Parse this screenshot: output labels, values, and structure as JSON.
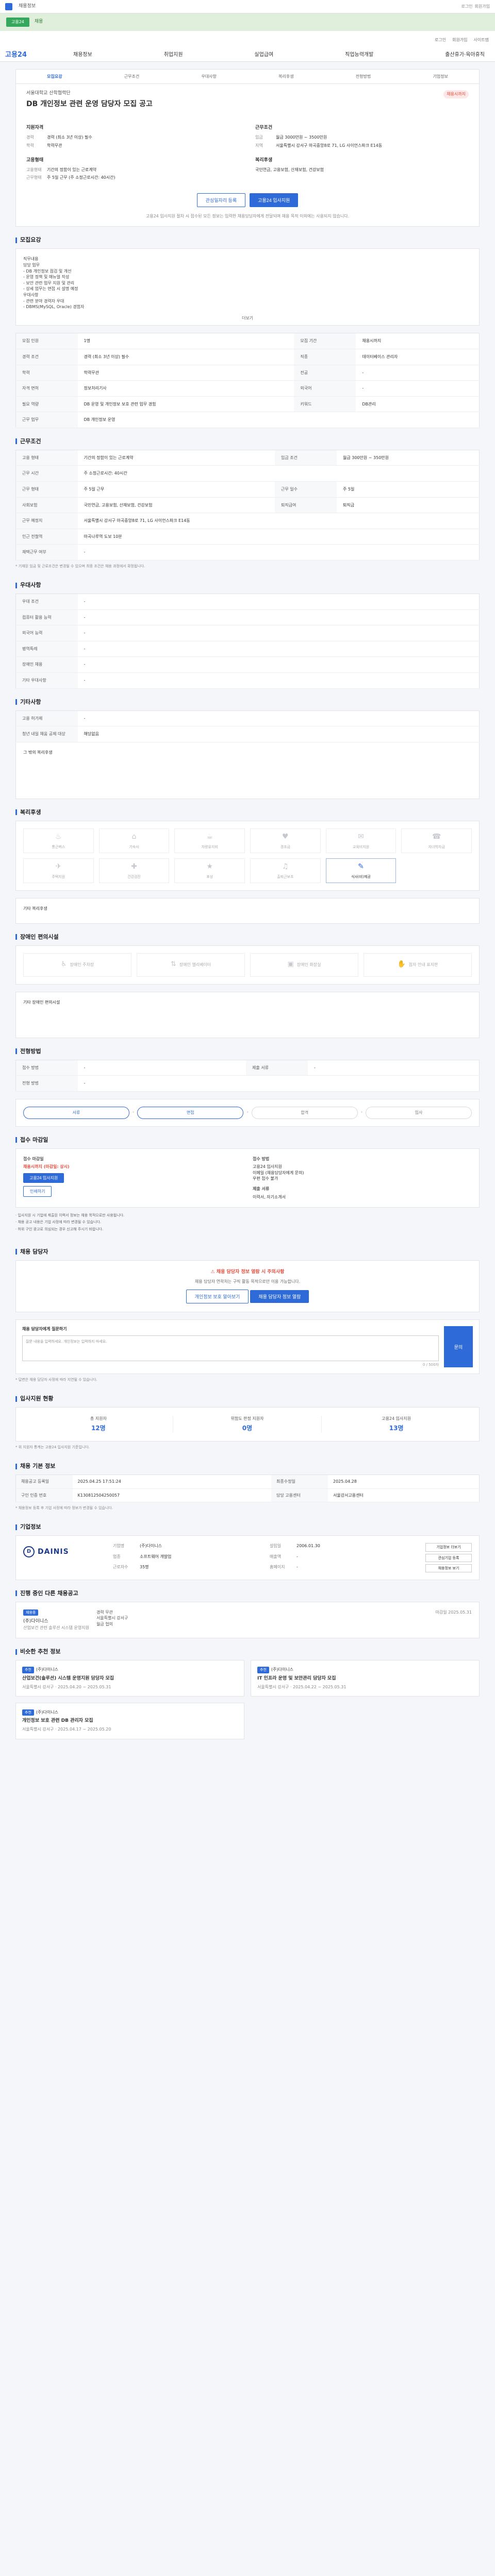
{
  "topbar": {
    "tab1": "채용정보",
    "links": [
      "로그인",
      "회원가입"
    ]
  },
  "greenbar": {
    "badge": "고용24",
    "text": "채용"
  },
  "util": {
    "items": [
      "로그인",
      "회원가입",
      "사이트맵"
    ]
  },
  "brand": "고용24",
  "mainnav": [
    "채용정보",
    "취업지원",
    "실업급여",
    "직업능력개발",
    "출산휴가·육아휴직"
  ],
  "tabs": [
    "모집요강",
    "근무조건",
    "우대사항",
    "복리후생",
    "전형방법",
    "기업정보"
  ],
  "job": {
    "company": "서울대학교 산학협력단",
    "title": "DB 개인정보 관련 운영 담당자 모집 공고",
    "status": "채용시까지",
    "recruit_head": "지원자격",
    "recruit": [
      {
        "k": "경력",
        "v": "경력 (최소 3년 이상) 필수"
      },
      {
        "k": "학력",
        "v": "학력무관"
      }
    ],
    "work_head": "근무조건",
    "work": [
      {
        "k": "임금",
        "v": "월급 3000만원 ~ 3500만원"
      },
      {
        "k": "지역",
        "v": "서울특별시 강서구 마곡중앙8로 71, LG 사이언스파크 E14동"
      }
    ],
    "emp_head": "고용형태",
    "emp": [
      {
        "k": "고용형태",
        "v": "기간의 정함이 있는 근로계약"
      },
      {
        "k": "근무형태",
        "v": "주 5일 근무 (주 소정근로시간: 40시간)"
      }
    ],
    "welfare_head": "복리후생",
    "welfare": [
      {
        "k": "",
        "v": "국민연금, 고용보험, 산재보험, 건강보험"
      }
    ],
    "btn_save": "관심일자리 등록",
    "btn_apply": "고용24 입사지원",
    "notice": "고용24 입사지원 절차 시 접수된 모든 정보는 입력한 채용담당자에게 전달되며 채용 목적 이외에는 사용되지 않습니다."
  },
  "sections": {
    "recruit": "모집요강",
    "conditions": "근무조건",
    "preference": "우대사항",
    "other": "기타사항",
    "welfare": "복리후생",
    "facility": "장애인 편의시설",
    "process": "전형방법",
    "reportTitle": "채용 담당자",
    "stats": "입사지원 현황",
    "info": "채용 기본 정보",
    "company": "기업정보",
    "ongoing": "진행 중인 다른 채용공고",
    "recommend": "비슷한 추천 정보"
  },
  "description": {
    "lines": [
      "직무내용",
      "담당 업무",
      "- DB 개인정보 점검 및 개선",
      "- 운영 정책 및 매뉴얼 작성",
      "- 보안 관련 업무 지원 및 관리",
      "- 상세 업무는 면접 시 설명 예정",
      "우대사항",
      "- 관련 분야 경력자 우대",
      "- DBMS(MySQL, Oracle) 경험자"
    ],
    "more": "더보기"
  },
  "recruit_table": [
    {
      "k": "모집 인원",
      "v": "1명",
      "k2": "모집 기간",
      "v2": "채용시까지"
    },
    {
      "k": "경력 조건",
      "v": "경력 (최소 3년 이상) 필수",
      "k2": "직종",
      "v2": "데이터베이스 관리자"
    },
    {
      "k": "학력",
      "v": "학력무관",
      "k2": "전공",
      "v2": "-"
    },
    {
      "k": "자격 면허",
      "v": "정보처리기사",
      "k2": "외국어",
      "v2": "-"
    },
    {
      "k": "필요 역량",
      "v": "DB 운영 및 개인정보 보호 관련 업무 경험",
      "k2": "키워드",
      "v2": "DB관리"
    },
    {
      "k": "근무 업무",
      "v": "DB 개인정보 운영",
      "k2": "",
      "v2": ""
    }
  ],
  "cond_table": [
    {
      "k": "고용 형태",
      "v": "기간의 정함이 있는 근로계약",
      "k2": "임금 조건",
      "v2": "월급 300만원 ~ 350만원"
    },
    {
      "k": "근무 시간",
      "v": "주 소정근로시간: 40시간",
      "k2": "",
      "v2": ""
    },
    {
      "k": "근무 형태",
      "v": "주 5일 근무",
      "k2": "근무 일수",
      "v2": "주 5일"
    },
    {
      "k": "사회보험",
      "v": "국민연금, 고용보험, 산재보험, 건강보험",
      "k2": "퇴직급여",
      "v2": "퇴직금"
    },
    {
      "k": "근무 예정지",
      "v": "서울특별시 강서구 마곡중앙8로 71, LG 사이언스파크 E14동",
      "k2": "",
      "v2": ""
    },
    {
      "k": "인근 전철역",
      "v": "마곡나루역 도보 10분",
      "k2": "",
      "v2": ""
    },
    {
      "k": "재택근무 여부",
      "v": "-",
      "k2": "",
      "v2": ""
    }
  ],
  "cond_note": "지도 보기",
  "cond_foot": "* 기재된 임금 및 근로조건은 변경될 수 있으며 최종 조건은 채용 과정에서 확정됩니다.",
  "pref_table": [
    {
      "k": "우대 조건",
      "v": "-"
    },
    {
      "k": "컴퓨터 활용 능력",
      "v": "-"
    },
    {
      "k": "외국어 능력",
      "v": "-"
    },
    {
      "k": "병역특례",
      "v": "-"
    },
    {
      "k": "장애인 채용",
      "v": "-"
    },
    {
      "k": "기타 우대사항",
      "v": "-"
    }
  ],
  "other_table": [
    {
      "k": "고용 허가제",
      "v": "-"
    },
    {
      "k": "청년 내일 채움 공제 대상",
      "v": "해당없음"
    }
  ],
  "other_extra": "그 밖의 복리후생",
  "welfare": [
    {
      "icon": "♨",
      "name": "통근버스"
    },
    {
      "icon": "⌂",
      "name": "기숙사"
    },
    {
      "icon": "☕",
      "name": "차량유지비"
    },
    {
      "icon": "♥",
      "name": "경조금"
    },
    {
      "icon": "✉",
      "name": "교육비지원"
    },
    {
      "icon": "☎",
      "name": "자녀학자금"
    },
    {
      "icon": "✈",
      "name": "주택지원"
    },
    {
      "icon": "✚",
      "name": "건강검진"
    },
    {
      "icon": "★",
      "name": "포상"
    },
    {
      "icon": "♫",
      "name": "출퇴근보조"
    },
    {
      "icon": "✎",
      "name": "식사(비)제공"
    }
  ],
  "welfare_extra": "기타 복리후생",
  "facility": [
    {
      "icon": "♿",
      "name": "장애인 주차장"
    },
    {
      "icon": "⇅",
      "name": "장애인 엘리베이터"
    },
    {
      "icon": "▣",
      "name": "장애인 화장실"
    },
    {
      "icon": "✋",
      "name": "점자 안내 표지판"
    }
  ],
  "facility_extra": "기타 장애인 편의시설",
  "process_table": [
    {
      "k": "접수 방법",
      "v": "-",
      "k2": "제출 서류",
      "v2": "-"
    },
    {
      "k": "전형 방법",
      "v": "-",
      "k2": "",
      "v2": ""
    }
  ],
  "steps": [
    "서류",
    "면접",
    "합격",
    "입사"
  ],
  "apply": {
    "period_label": "접수 마감일",
    "period_value": "채용시까지 (마감일: 상시)",
    "method_label": "접수 방법",
    "method_lines": [
      "고용24 입사지원",
      "이메일 (채용담당자에게 문의)",
      "우편 접수 불가"
    ],
    "btn_apply": "고용24 입사지원",
    "btn_print": "인쇄하기",
    "docs_label": "제출 서류",
    "docs_value": "이력서, 자기소개서"
  },
  "bullets": [
    "· 입사지원 시 기업에 제출된 이력서 정보는 채용 목적으로만 사용됩니다.",
    "· 채용 공고 내용은 기업 사정에 따라 변경될 수 있습니다.",
    "· 허위 구인 광고로 의심되는 경우 신고해 주시기 바랍니다."
  ],
  "report": {
    "alert": "⚠ 채용 담당자 정보 열람 시 주의사항",
    "desc": "채용 담당자 연락처는 구직 활동 목적으로만 이용 가능합니다.",
    "btn1": "개인정보 보호 알아보기",
    "btn2": "채용 담당자 정보 열람"
  },
  "inquiry": {
    "label": "채용 담당자에게 질문하기",
    "placeholder": "질문 내용을 입력하세요. 개인정보는 입력하지 마세요.",
    "counter": "0 / 500자",
    "btn": "문의"
  },
  "inquiry_note": "* 답변은 채용 담당자 사정에 따라 지연될 수 있습니다.",
  "stats": [
    {
      "label": "총 지원자",
      "value": "12명"
    },
    {
      "label": "위험도 판정 지원자",
      "value": "0명"
    },
    {
      "label": "고용24 입사지원",
      "value": "13명"
    }
  ],
  "stats_note": "* 위 지원자 통계는 고용24 입사지원 기준입니다.",
  "info_table": [
    {
      "k": "채용공고 등록일",
      "v": "2025.04.25 17:51:24",
      "k2": "최종수정일",
      "v2": "2025.04.28"
    },
    {
      "k": "구인 인증 번호",
      "v": "K130812504250057",
      "k2": "담당 고용센터",
      "v2": "서울강서고용센터"
    }
  ],
  "info_note": "* 채용정보 등록 후 기업 사정에 따라 정보가 변경될 수 있습니다.",
  "company": {
    "logo_mark": "D",
    "logo_word": "DAINIS",
    "rows": [
      {
        "k": "기업명",
        "v": "(주)다이니스"
      },
      {
        "k": "설립일",
        "v": "2006.01.30"
      },
      {
        "k": "업종",
        "v": "소프트웨어 개발업"
      },
      {
        "k": "매출액",
        "v": "-"
      },
      {
        "k": "근로자수",
        "v": "35명"
      },
      {
        "k": "홈페이지",
        "v": "-"
      }
    ],
    "btns": [
      "기업정보 더보기",
      "관심기업 등록",
      "채용정보 보기"
    ]
  },
  "ongoing": {
    "badge": "채용중",
    "name": "(주)다이니스",
    "title": "산업보건 관련 솔루션 시스템 운영지원",
    "mid": [
      "경력 무관",
      "서울특별시 강서구",
      "월급 협의"
    ],
    "date": "마감일 2025.05.31"
  },
  "recommend": [
    {
      "badge": "추천",
      "name": "(주)다이니스",
      "title": "산업보건(솔루션) 시스템 운영지원 담당자 모집",
      "meta": "서울특별시 강서구 · 2025.04.20 ~ 2025.05.31"
    },
    {
      "badge": "추천",
      "name": "(주)다이니스",
      "title": "IT 인프라 운영 및 보안관리 담당자 모집",
      "meta": "서울특별시 강서구 · 2025.04.22 ~ 2025.05.31"
    },
    {
      "badge": "추천",
      "name": "(주)다이니스",
      "title": "개인정보 보호 관련 DB 관리자 모집",
      "meta": "서울특별시 강서구 · 2025.04.17 ~ 2025.05.20"
    }
  ]
}
